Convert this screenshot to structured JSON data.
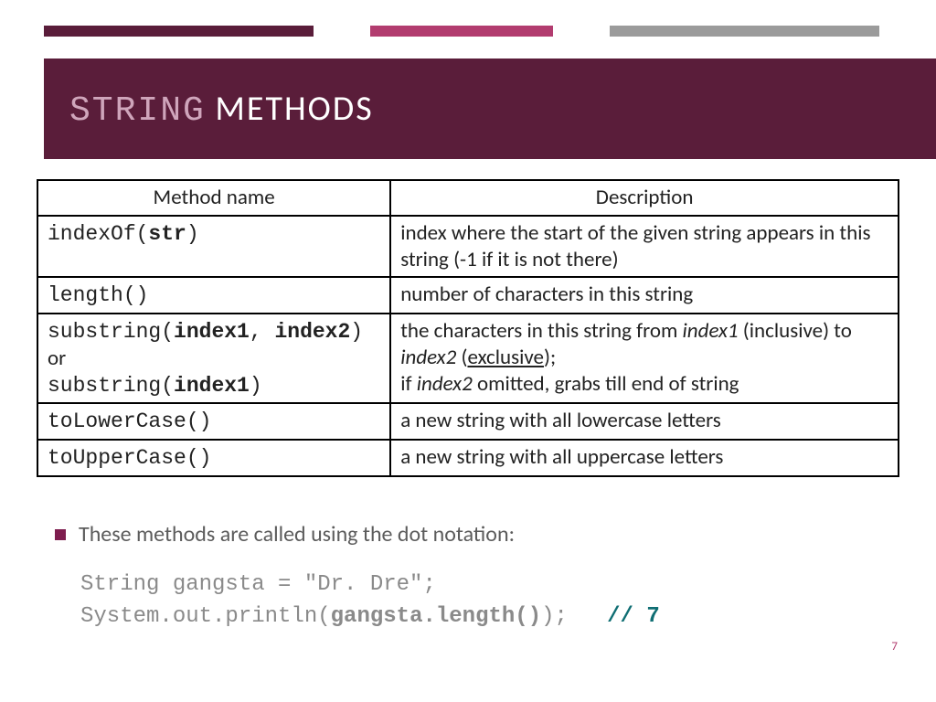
{
  "title": {
    "mono": "STRING",
    "rest": " METHODS"
  },
  "table": {
    "headers": [
      "Method name",
      "Description"
    ],
    "rows": [
      {
        "method_html": "<span class='mono'>indexOf(<span class='b'>str</span>)</span>",
        "desc_html": "index where the start of the given string appears in this string (-1 if it is not there)"
      },
      {
        "method_html": "<span class='mono'>length()</span>",
        "desc_html": "number of characters in this string"
      },
      {
        "method_html": "<span class='mono'>substring(<span class='b'>index1</span>, <span class='b'>index2</span>)</span><br>or<br><span class='mono'>substring(<span class='b'>index1</span>)</span>",
        "desc_html": "the characters in this string from <span class='i'>index1</span> (inclusive) to <span class='i'>index2</span> (<span class='u'>exclusive</span>);<br>if <span class='i'>index2</span> omitted, grabs till end of string"
      },
      {
        "method_html": "<span class='mono'>toLowerCase()</span>",
        "desc_html": "a new string with all lowercase letters"
      },
      {
        "method_html": "<span class='mono'>toUpperCase()</span>",
        "desc_html": "a new string with all uppercase letters"
      }
    ]
  },
  "bullet_text": "These methods are called using the dot notation:",
  "code": {
    "line1": "String gangsta = \"Dr. Dre\";",
    "line2a": "System.out.println(",
    "line2b": "gangsta.length()",
    "line2c": ");   ",
    "line2d": "// 7"
  },
  "page_number": "7"
}
